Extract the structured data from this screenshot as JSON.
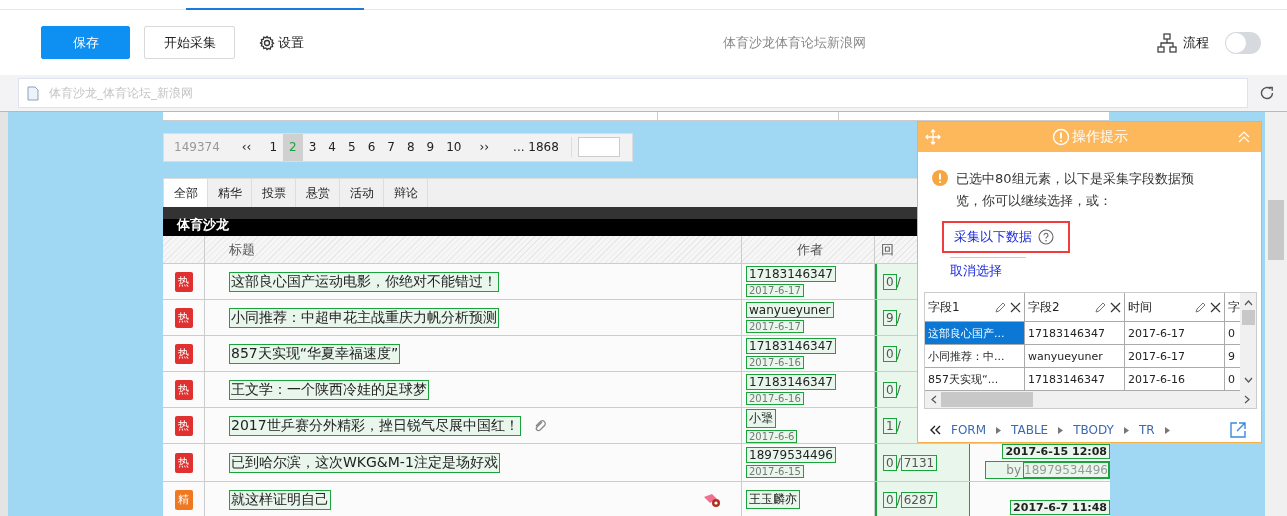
{
  "toolbar": {
    "buttons": [
      {
        "label": "保存",
        "kind": "primary"
      },
      {
        "label": "开始采集",
        "kind": "default"
      }
    ],
    "settings": "设置",
    "page_title": "体育沙龙体育论坛新浪网",
    "flow_label": "流程",
    "flow_toggle": {
      "on": false
    }
  },
  "address_bar": {
    "placeholder": "体育沙龙_体育论坛_新浪网"
  },
  "pagination": {
    "total": "149374",
    "prev": "‹‹",
    "pages": [
      {
        "label": "1",
        "selected": false
      },
      {
        "label": "2",
        "selected": true
      },
      {
        "label": "3",
        "selected": false
      },
      {
        "label": "4",
        "selected": false
      },
      {
        "label": "5",
        "selected": false
      },
      {
        "label": "6",
        "selected": false
      },
      {
        "label": "7",
        "selected": false
      },
      {
        "label": "8",
        "selected": false
      },
      {
        "label": "9",
        "selected": false
      },
      {
        "label": "10",
        "selected": false
      }
    ],
    "next": "››",
    "last": "... 1868"
  },
  "tabs": [
    {
      "label": "全部",
      "selected": true
    },
    {
      "label": "精华",
      "selected": false
    },
    {
      "label": "投票",
      "selected": false
    },
    {
      "label": "悬赏",
      "selected": false
    },
    {
      "label": "活动",
      "selected": false
    },
    {
      "label": "辩论",
      "selected": false
    }
  ],
  "forum_title": "体育沙龙",
  "columns": [
    "标题",
    "作者",
    "回"
  ],
  "rows": [
    {
      "badge": "热",
      "kind": "hot",
      "has_attachment": false,
      "has_reward": false,
      "title": "这部良心国产运动电影，你绝对不能错过！",
      "author": "17183146347",
      "date": "2017-6-17",
      "reply": "0",
      "reply_rest": "/"
    },
    {
      "badge": "热",
      "kind": "hot",
      "has_attachment": false,
      "has_reward": false,
      "title": "小同推荐：中超申花主战重庆力帆分析预测",
      "author": "wanyueyuner",
      "date": "2017-6-17",
      "reply": "9",
      "reply_rest": "/"
    },
    {
      "badge": "热",
      "kind": "hot",
      "has_attachment": false,
      "has_reward": false,
      "title": "857天实现“华夏幸福速度”",
      "author": "17183146347",
      "date": "2017-6-16",
      "reply": "0",
      "reply_rest": "/"
    },
    {
      "badge": "热",
      "kind": "hot",
      "has_attachment": false,
      "has_reward": false,
      "title": "王文学：一个陕西冷娃的足球梦",
      "author": "17183146347",
      "date": "2017-6-16",
      "reply": "0",
      "reply_rest": "/"
    },
    {
      "badge": "热",
      "kind": "hot",
      "has_attachment": true,
      "has_reward": false,
      "title": "2017世乒赛分外精彩，挫日锐气尽展中国红！",
      "author": "小犟",
      "date": "2017-6-6",
      "reply": "1",
      "reply_rest": "/"
    },
    {
      "badge": "热",
      "kind": "hot",
      "has_attachment": false,
      "has_reward": false,
      "title": "已到哈尔滨，这次WKG&M-1注定是场好戏",
      "author": "18979534496",
      "date": "2017-6-15",
      "reply": "0",
      "reply_rest": "/",
      "views": "7131",
      "last_time": "2017-6-15 12:08",
      "last_by": "by",
      "last_user": "18979534496"
    },
    {
      "badge": "精",
      "kind": "digest",
      "has_attachment": false,
      "has_reward": true,
      "title": "就这样证明自己",
      "author": "王玉麟亦",
      "reply": "0",
      "reply_rest": "/",
      "views": "6287",
      "last_time": "2017-6-7 11:48"
    }
  ],
  "panel": {
    "title": "操作提示",
    "message": "已选中80组元素，以下是采集字段数据预览，你可以继续选择，或：",
    "collect_link": "采集以下数据",
    "cancel_link": "取消选择",
    "preview": {
      "columns": [
        "字段1",
        "字段2",
        "时间",
        "字"
      ],
      "rows": [
        {
          "cells": [
            "这部良心国产...",
            "17183146347",
            "2017-6-17",
            "0"
          ],
          "selected": true
        },
        {
          "cells": [
            "小同推荐：中...",
            "wanyueyuner",
            "2017-6-17",
            "9"
          ],
          "selected": false
        },
        {
          "cells": [
            "857天实现“...",
            "17183146347",
            "2017-6-16",
            "0"
          ],
          "selected": false
        }
      ]
    },
    "breadcrumb": [
      "FORM",
      "TABLE",
      "TBODY",
      "TR"
    ]
  }
}
